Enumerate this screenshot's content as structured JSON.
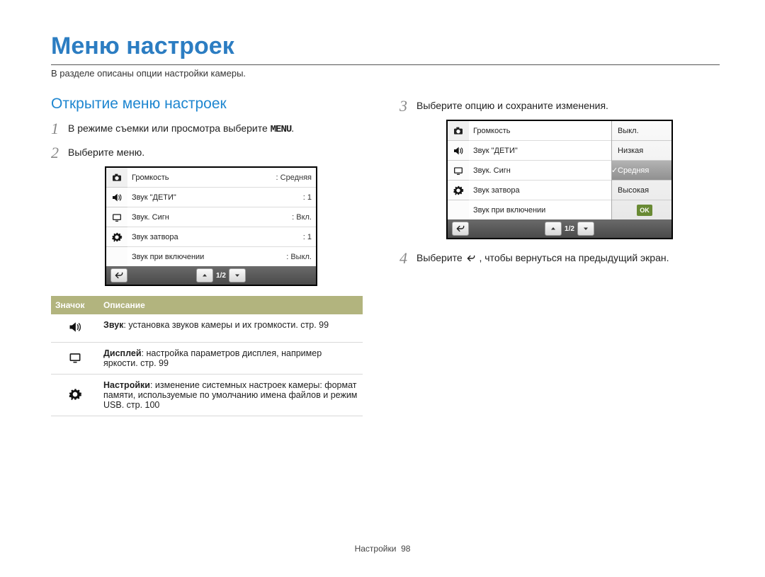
{
  "title": "Меню настроек",
  "intro": "В разделе описаны опции настройки камеры.",
  "section_title": "Открытие меню настроек",
  "steps": {
    "1": {
      "num": "1",
      "pre": "В режиме съемки или просмотра выберите ",
      "menu": "MENU",
      "post": "."
    },
    "2": {
      "num": "2",
      "text": "Выберите меню."
    },
    "3": {
      "num": "3",
      "text": "Выберите опцию и сохраните изменения."
    },
    "4": {
      "num": "4",
      "pre": "Выберите ",
      "post": ", чтобы вернуться на предыдущий экран."
    }
  },
  "screen1": {
    "rows": [
      {
        "label": "Громкость",
        "value": ": Средняя"
      },
      {
        "label": "Звук \"ДЕТИ\"",
        "value": ": 1"
      },
      {
        "label": "Звук. Сигн",
        "value": ": Вкл."
      },
      {
        "label": "Звук затвора",
        "value": ": 1"
      },
      {
        "label": "Звук при включении",
        "value": ": Выкл."
      }
    ],
    "page": "1/2"
  },
  "screen2": {
    "rows": [
      {
        "label": "Громкость"
      },
      {
        "label": "Звук \"ДЕТИ\""
      },
      {
        "label": "Звук. Сигн"
      },
      {
        "label": "Звук затвора"
      },
      {
        "label": "Звук при включении"
      }
    ],
    "popup": {
      "items": [
        "Выкл.",
        "Низкая",
        "Средняя",
        "Высокая"
      ],
      "ok": "OK"
    },
    "page": "1/2"
  },
  "table": {
    "th_icon": "Значок",
    "th_desc": "Описание",
    "rows": [
      {
        "bold": "Звук",
        "rest": ": установка звуков камеры и их громкости. стр. 99"
      },
      {
        "bold": "Дисплей",
        "rest": ": настройка параметров дисплея, например яркости. стр. 99"
      },
      {
        "bold": "Настройки",
        "rest": ": изменение системных настроек камеры: формат памяти, используемые по умолчанию имена файлов и режим USB. стр. 100"
      }
    ]
  },
  "footer": {
    "section": "Настройки",
    "page": "98"
  }
}
